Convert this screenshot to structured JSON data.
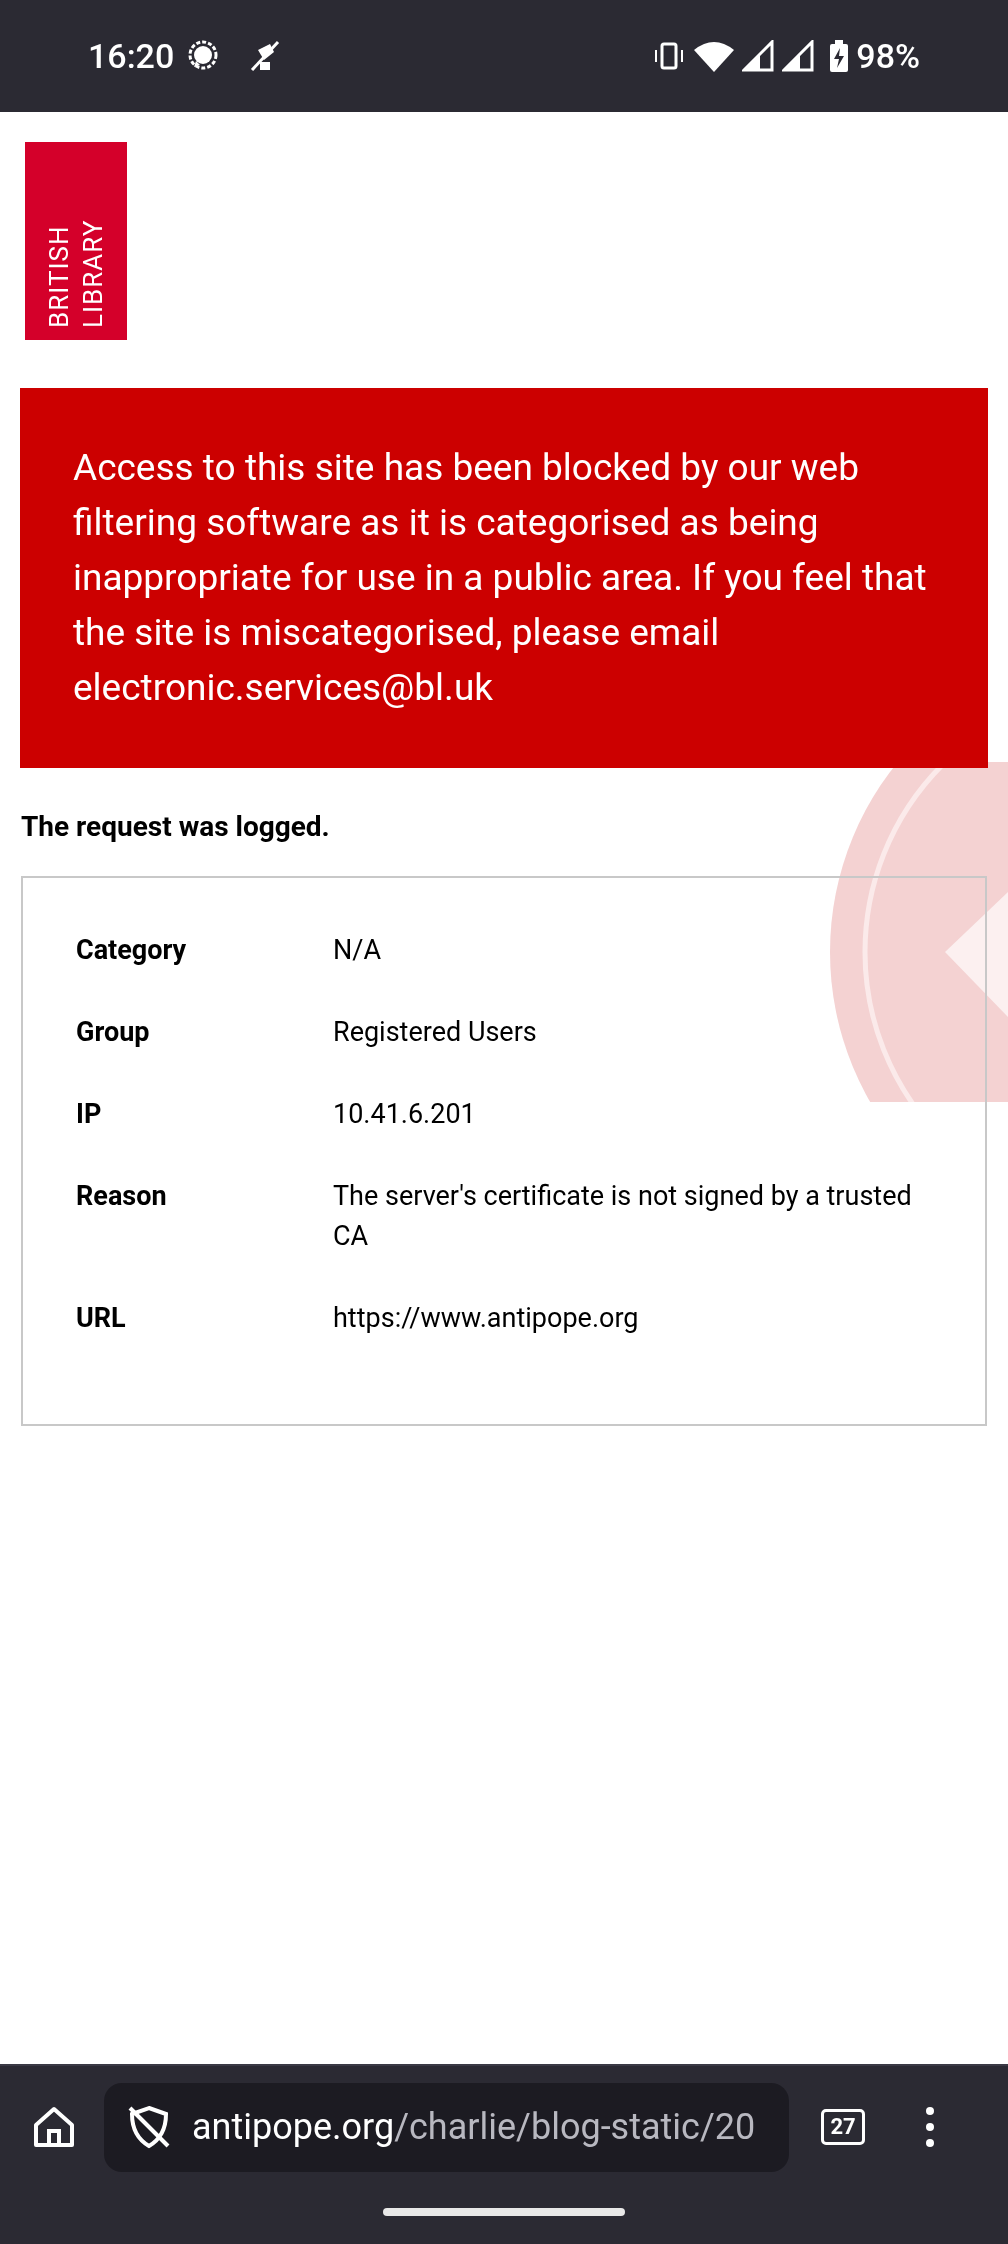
{
  "status_bar": {
    "time": "16:20",
    "battery": "98%"
  },
  "logo": {
    "words": [
      "BRITISH",
      "LIBRARY"
    ]
  },
  "banner": {
    "message": "Access to this site has been blocked by our web filtering software as it is categorised as being inappropriate for use in a public area. If you feel that the site is miscategorised, please email electronic.services@bl.uk"
  },
  "notice": "The request was logged.",
  "details": [
    {
      "label": "Category",
      "value": "N/A"
    },
    {
      "label": "Group",
      "value": "Registered Users"
    },
    {
      "label": "IP",
      "value": "10.41.6.201"
    },
    {
      "label": "Reason",
      "value": "The server's certificate is not signed by a trusted CA"
    },
    {
      "label": "URL",
      "value": "https://www.antipope.org"
    }
  ],
  "browser_bar": {
    "url_host": "antipope.org",
    "url_path": "/charlie/blog-static/20",
    "tab_count": "27"
  }
}
